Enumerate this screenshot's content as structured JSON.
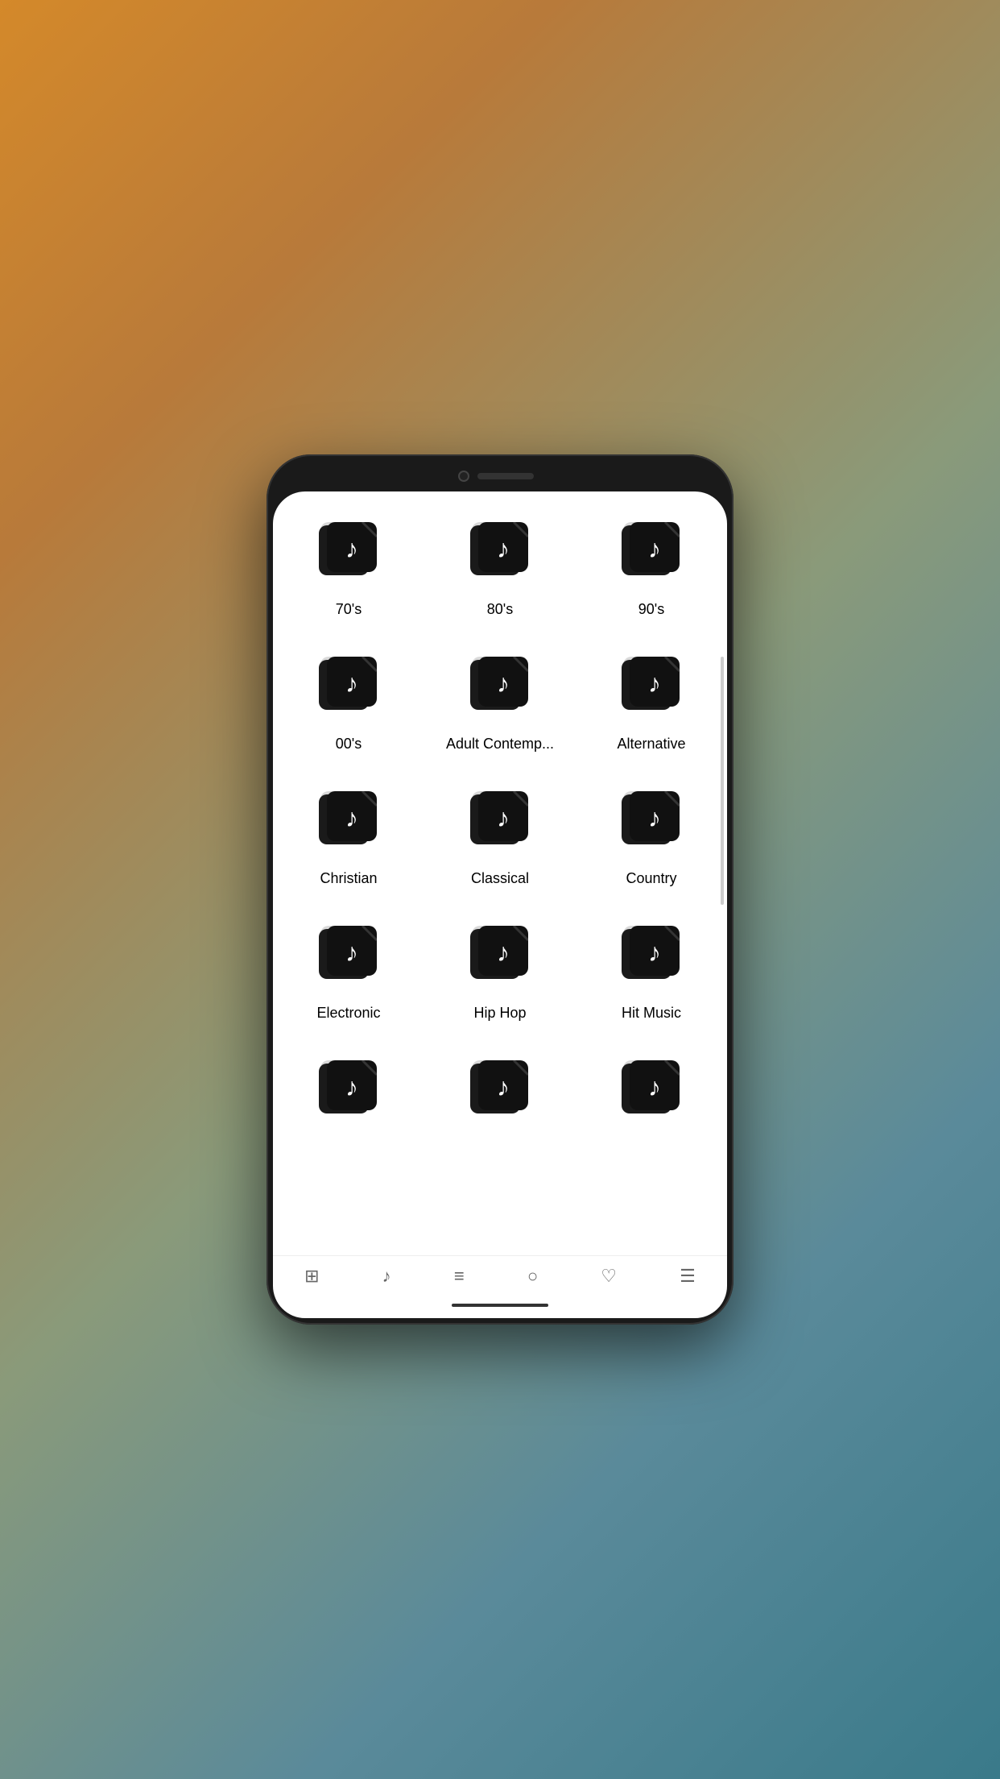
{
  "genres": [
    {
      "id": "70s",
      "label": "70's"
    },
    {
      "id": "80s",
      "label": "80's"
    },
    {
      "id": "90s",
      "label": "90's"
    },
    {
      "id": "00s",
      "label": "00's"
    },
    {
      "id": "adult-contemp",
      "label": "Adult Contemp..."
    },
    {
      "id": "alternative",
      "label": "Alternative"
    },
    {
      "id": "christian",
      "label": "Christian"
    },
    {
      "id": "classical",
      "label": "Classical"
    },
    {
      "id": "country",
      "label": "Country"
    },
    {
      "id": "electronic",
      "label": "Electronic"
    },
    {
      "id": "hip-hop",
      "label": "Hip Hop"
    },
    {
      "id": "hit-music",
      "label": "Hit Music"
    },
    {
      "id": "row5col1",
      "label": ""
    },
    {
      "id": "row5col2",
      "label": ""
    },
    {
      "id": "row5col3",
      "label": ""
    }
  ],
  "nav": {
    "icons": [
      "⊞",
      "♪",
      "≡",
      "○",
      "♡",
      "☰"
    ]
  }
}
